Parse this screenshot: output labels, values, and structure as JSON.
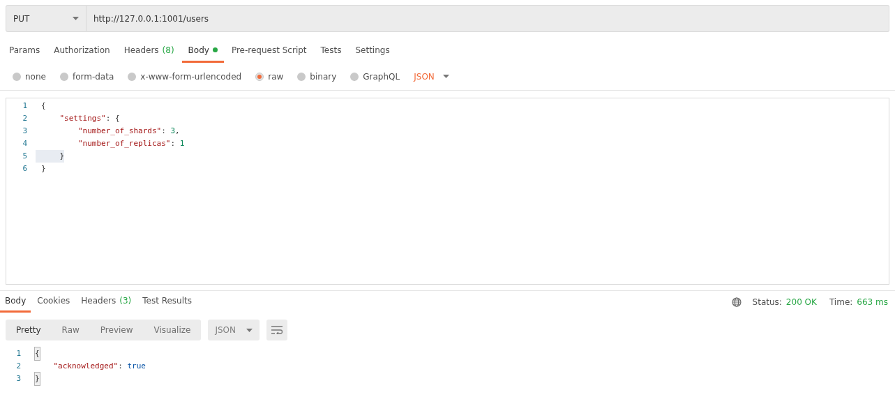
{
  "request": {
    "method": "PUT",
    "url": "http://127.0.0.1:1001/users"
  },
  "request_tabs": [
    {
      "label": "Params",
      "selected": false
    },
    {
      "label": "Authorization",
      "selected": false
    },
    {
      "label": "Headers",
      "count": "(8)",
      "selected": false
    },
    {
      "label": "Body",
      "dot": true,
      "selected": true
    },
    {
      "label": "Pre-request Script",
      "selected": false
    },
    {
      "label": "Tests",
      "selected": false
    },
    {
      "label": "Settings",
      "selected": false
    }
  ],
  "body_types": [
    {
      "label": "none",
      "selected": false
    },
    {
      "label": "form-data",
      "selected": false
    },
    {
      "label": "x-www-form-urlencoded",
      "selected": false
    },
    {
      "label": "raw",
      "selected": true
    },
    {
      "label": "binary",
      "selected": false
    },
    {
      "label": "GraphQL",
      "selected": false
    }
  ],
  "raw_format": "JSON",
  "editor": {
    "lines": [
      {
        "number": "1",
        "highlighted": false,
        "tokens": [
          {
            "kind": "punct",
            "text": "{"
          }
        ]
      },
      {
        "number": "2",
        "highlighted": false,
        "tokens": [
          {
            "kind": "key",
            "text": "    \"settings\""
          },
          {
            "kind": "punct",
            "text": ": {"
          }
        ]
      },
      {
        "number": "3",
        "highlighted": false,
        "tokens": [
          {
            "kind": "key",
            "text": "        \"number_of_shards\""
          },
          {
            "kind": "punct",
            "text": ": "
          },
          {
            "kind": "number",
            "text": "3"
          },
          {
            "kind": "punct",
            "text": ","
          }
        ]
      },
      {
        "number": "4",
        "highlighted": false,
        "tokens": [
          {
            "kind": "key",
            "text": "        \"number_of_replicas\""
          },
          {
            "kind": "punct",
            "text": ": "
          },
          {
            "kind": "number",
            "text": "1"
          }
        ]
      },
      {
        "number": "5",
        "highlighted": true,
        "tokens": [
          {
            "kind": "punct",
            "text": "    }"
          }
        ]
      },
      {
        "number": "6",
        "highlighted": false,
        "tokens": [
          {
            "kind": "punct",
            "text": "}"
          }
        ]
      }
    ]
  },
  "response_tabs": [
    {
      "label": "Body",
      "selected": true
    },
    {
      "label": "Cookies",
      "selected": false
    },
    {
      "label": "Headers",
      "count": "(3)",
      "selected": false
    },
    {
      "label": "Test Results",
      "selected": false
    }
  ],
  "status": {
    "label": "Status:",
    "value": "200 OK"
  },
  "time": {
    "label": "Time:",
    "value": "663 ms"
  },
  "view_modes": [
    {
      "label": "Pretty",
      "selected": true
    },
    {
      "label": "Raw",
      "selected": false
    },
    {
      "label": "Preview",
      "selected": false
    },
    {
      "label": "Visualize",
      "selected": false
    }
  ],
  "response_format": "JSON",
  "response": {
    "lines": [
      {
        "number": "1",
        "tokens": [
          {
            "kind": "punct",
            "text": "{",
            "matched": true
          }
        ]
      },
      {
        "number": "2",
        "tokens": [
          {
            "kind": "key",
            "text": "    \"acknowledged\""
          },
          {
            "kind": "punct",
            "text": ": "
          },
          {
            "kind": "keyword",
            "text": "true"
          }
        ]
      },
      {
        "number": "3",
        "tokens": [
          {
            "kind": "punct",
            "text": "}",
            "matched": true
          }
        ]
      }
    ]
  }
}
